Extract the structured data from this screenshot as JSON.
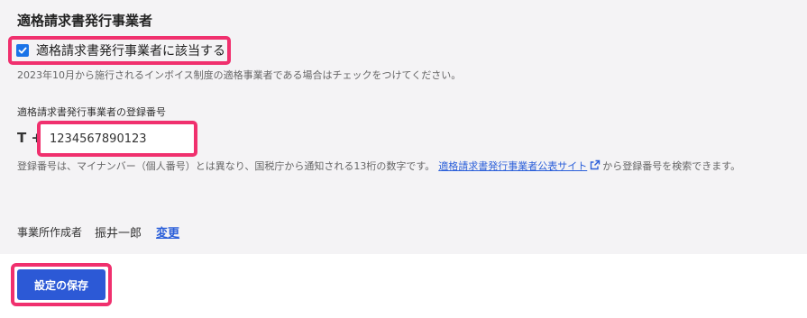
{
  "section": {
    "title": "適格請求書発行事業者"
  },
  "invoice_checkbox": {
    "label": "適格請求書発行事業者に該当する",
    "checked": true,
    "hint": "2023年10月から施行されるインボイス制度の適格事業者である場合はチェックをつけてください。"
  },
  "registration": {
    "label": "適格請求書発行事業者の登録番号",
    "prefix": "T +",
    "value": "1234567890123",
    "description_before": "登録番号は、マイナンバー（個人番号）とは異なり、国税庁から通知される13桁の数字です。",
    "link_text": "適格請求書発行事業者公表サイト",
    "description_after": "から登録番号を検索できます。"
  },
  "author": {
    "label": "事業所作成者",
    "name": "振井一郎",
    "change_link": "変更"
  },
  "actions": {
    "save_label": "設定の保存"
  },
  "colors": {
    "highlight": "#f0306e",
    "primary_button": "#2c59d6",
    "link": "#2b5fd9",
    "checkbox": "#1a73e8",
    "panel_bg": "#f4f3f5"
  },
  "icons": {
    "checkbox": "checkmark-icon",
    "external_link": "external-link-icon"
  }
}
